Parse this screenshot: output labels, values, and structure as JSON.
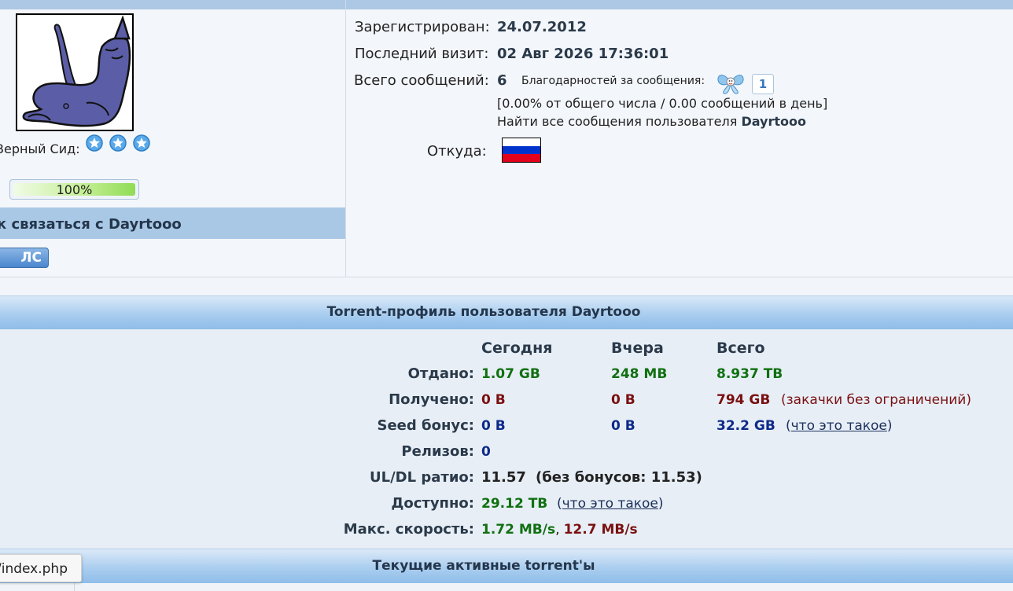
{
  "profile": {
    "rank_label": "Верный Сид:",
    "progress": {
      "text": "100%",
      "fraction": 1.0
    },
    "contact_title": "к связаться с Dayrtooo",
    "pm_button": "ЛС",
    "registered_label": "Зарегистрирован:",
    "registered_value": "24.07.2012",
    "last_visit_label": "Последний визит:",
    "last_visit_value": "02 Авг 2026 17:36:01",
    "posts_label": "Всего сообщений:",
    "posts_value": "6",
    "thanks_label": "Благодарностей за сообщения:",
    "thanks_count": "1",
    "stats_line": "[0.00% от общего числа / 0.00 сообщений в день]",
    "find_posts_prefix": "Найти все сообщения пользователя",
    "find_posts_user": "Dayrtooo",
    "from_label": "Откуда:",
    "flag_colors": [
      "#ffffff",
      "#0033cc",
      "#e3001b"
    ]
  },
  "torrent": {
    "title": "Torrent-профиль пользователя Dayrtooo",
    "columns": [
      "Сегодня",
      "Вчера",
      "Всего"
    ],
    "rows": {
      "uploaded": {
        "label": "Отдано:",
        "today": "1.07 GB",
        "yesterday": "248 MB",
        "total": "8.937 TB"
      },
      "downloaded": {
        "label": "Получено:",
        "today": "0 B",
        "yesterday": "0 B",
        "total": "794 GB",
        "note": "(закачки без ограничений)"
      },
      "seed_bonus": {
        "label": "Seed бонус:",
        "today": "0 B",
        "yesterday": "0 B",
        "total": "32.2 GB",
        "note_open": "(",
        "note_link": "что это такое",
        "note_close": ")"
      },
      "releases": {
        "label": "Релизов:",
        "value": "0"
      },
      "ratio": {
        "label": "UL/DL ратио:",
        "value": "11.57",
        "note": "(без бонусов: 11.53)"
      },
      "available": {
        "label": "Доступно:",
        "value": "29.12 TB",
        "note_open": "(",
        "note_link": "что это такое",
        "note_close": ")"
      },
      "max_speed": {
        "label": "Макс. скорость:",
        "up": "1.72 MB/s",
        "sep": ",",
        "down": "12.7 MB/s"
      }
    },
    "colors": {
      "green": "#107010",
      "red": "#7a1010",
      "blue": "#0e2a88"
    }
  },
  "active": {
    "title": "Текущие активные torrent'ы"
  },
  "status_bar": {
    "url": "/index.php"
  }
}
